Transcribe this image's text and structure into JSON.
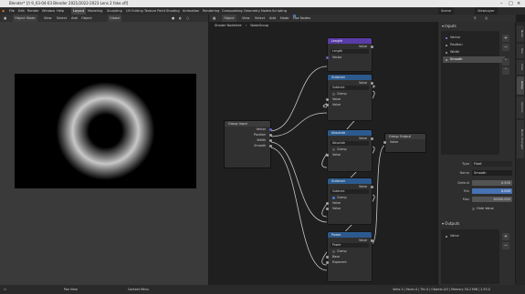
{
  "window": {
    "title": "Blender* [/\\ 9_03-04-03 Blender 2021/2022-2023 Lens 2 fake.vfl]"
  },
  "menubar": {
    "items": [
      "File",
      "Edit",
      "Render",
      "Window",
      "Help"
    ],
    "workspaces": [
      "Layout",
      "Modeling",
      "Sculpting",
      "UV Editing",
      "Texture Paint",
      "Shading",
      "Animation",
      "Rendering",
      "Compositing",
      "Geometry Nodes",
      "Scripting"
    ],
    "scene": "Scene",
    "view_layer": "ViewLayer"
  },
  "viewport_header": {
    "mode": "Object Mode",
    "menus": [
      "View",
      "Select",
      "Add",
      "Object"
    ],
    "shading": "Global"
  },
  "node_header": {
    "menus": [
      "Object",
      "View",
      "Select",
      "Add",
      "Node"
    ],
    "use_nodes": "Use Nodes"
  },
  "breadcrumb": {
    "items": [
      "Shader Nodetree",
      "NodeGroup"
    ]
  },
  "nodes": {
    "group_input": {
      "title": "Group Input",
      "outputs": [
        "Vector",
        "Position",
        "Width",
        "Smooth"
      ]
    },
    "length": {
      "title": "Length",
      "out": "Value",
      "op": "Length",
      "in": "Vector"
    },
    "subtract1": {
      "title": "Subtract",
      "out": "Value",
      "op": "Subtract",
      "clamp": "Clamp",
      "in1": "Value",
      "in2": "Value"
    },
    "absolute": {
      "title": "Absolute",
      "out": "Value",
      "op": "Absolute",
      "clamp": "Clamp",
      "in1": "Value"
    },
    "subtract2": {
      "title": "Subtract",
      "out": "Value",
      "op": "Subtract",
      "clamp": "Clamp",
      "in1": "Value",
      "in2": "Value"
    },
    "power": {
      "title": "Power",
      "out": "Value",
      "op": "Power",
      "clamp": "Clamp",
      "in1": "Base",
      "in2": "Exponent"
    },
    "group_output": {
      "title": "Group Output",
      "in": "Value"
    }
  },
  "side_panel": {
    "inputs_header": "Inputs",
    "inputs": [
      "Vector",
      "Position",
      "Width",
      "Smooth"
    ],
    "selected": "Smooth",
    "type_label": "Type",
    "type_value": "Float",
    "name_label": "Name",
    "name_value": "Smooth",
    "default_label": "Default",
    "default_value": "0.500",
    "min_label": "Min",
    "min_value": "0.000",
    "max_label": "Max",
    "max_value": "10000.000",
    "hide_value": "Hide Value",
    "outputs_header": "Outputs",
    "outputs": [
      "Value"
    ]
  },
  "vtabs": [
    "Node",
    "Tool",
    "View",
    "Group",
    "Options",
    "Node Wrangler"
  ],
  "statusbar": {
    "left": "Pan View",
    "middle": "Context Menu",
    "right": "Verts 0 | Faces 0 | Tris 0 | Objects 0/3 | Memory 50.2 MiB | 2.93.0"
  },
  "colors": {
    "math_header": "#2c5a8e",
    "accent": "#4772b3",
    "link": "#c8c8c8"
  }
}
